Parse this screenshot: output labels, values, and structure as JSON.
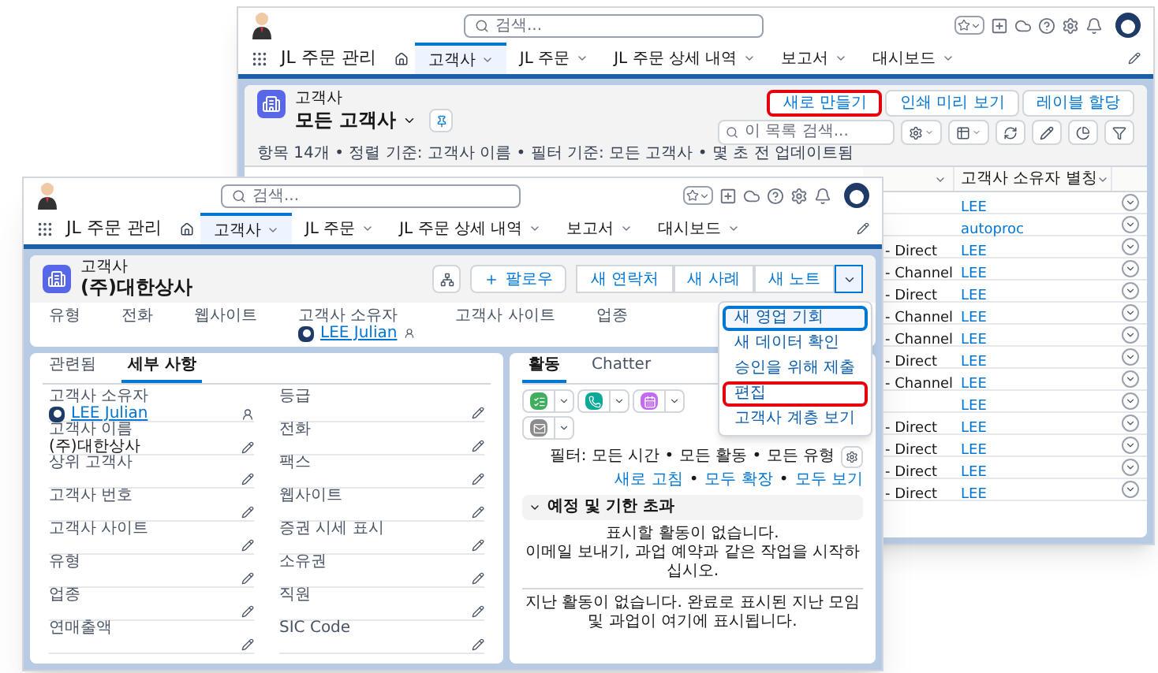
{
  "back_window": {
    "header": {
      "search_placeholder": "검색..."
    },
    "nav": {
      "app_name": "JL 주문 관리",
      "tabs": [
        {
          "label": "고객사",
          "selected": true
        },
        {
          "label": "JL 주문",
          "selected": false
        },
        {
          "label": "JL 주문 상세 내역",
          "selected": false
        },
        {
          "label": "보고서",
          "selected": false
        },
        {
          "label": "대시보드",
          "selected": false
        }
      ]
    },
    "list": {
      "object_label": "고객사",
      "title": "모든 고객사",
      "buttons": [
        {
          "label": "새로 만들기",
          "highlighted": true
        },
        {
          "label": "인쇄 미리 보기",
          "highlighted": false
        },
        {
          "label": "레이블 할당",
          "highlighted": false
        }
      ],
      "search_placeholder": "이 목록 검색...",
      "summary": "항목 14개 • 정렬 기준: 고객사 이름 • 필터 기준: 모든 고객사 • 몇 초 전 업데이트됨",
      "table": {
        "heading": "고객사 소유자 별칭",
        "rows": [
          {
            "owner_alias": "LEE"
          },
          {
            "owner_alias": "autoproc"
          },
          {
            "column_1": "- Direct",
            "owner_alias": "LEE"
          },
          {
            "column_1": "- Channel",
            "owner_alias": "LEE"
          },
          {
            "column_1": "- Direct",
            "owner_alias": "LEE"
          },
          {
            "column_1": "- Channel",
            "owner_alias": "LEE"
          },
          {
            "column_1": "- Channel",
            "owner_alias": "LEE"
          },
          {
            "column_1": "- Direct",
            "owner_alias": "LEE"
          },
          {
            "column_1": "- Channel",
            "owner_alias": "LEE"
          },
          {
            "owner_alias": "LEE"
          },
          {
            "column_1": "- Direct",
            "owner_alias": "LEE"
          },
          {
            "column_1": "- Direct",
            "owner_alias": "LEE"
          },
          {
            "column_1": "- Direct",
            "owner_alias": "LEE"
          },
          {
            "column_1": "- Direct",
            "owner_alias": "LEE"
          }
        ]
      }
    }
  },
  "front_window": {
    "header": {
      "search_placeholder": "검색..."
    },
    "nav": {
      "app_name": "JL 주문 관리",
      "tabs": [
        {
          "label": "고객사",
          "selected": true
        },
        {
          "label": "JL 주문",
          "selected": false
        },
        {
          "label": "JL 주문 상세 내역",
          "selected": false
        },
        {
          "label": "보고서",
          "selected": false
        },
        {
          "label": "대시보드",
          "selected": false
        }
      ]
    },
    "record": {
      "object_label": "고객사",
      "name": "(주)대한상사",
      "follow_label": "팔로우",
      "actions": [
        "새 연락처",
        "새 사례",
        "새 노트"
      ],
      "menu_open": true,
      "menu": [
        {
          "label": "새 영업 기회",
          "focused": true,
          "highlighted": false
        },
        {
          "label": "새 데이터 확인",
          "focused": false,
          "highlighted": false
        },
        {
          "label": "승인을 위해 제출",
          "focused": false,
          "highlighted": false
        },
        {
          "label": "편집",
          "focused": false,
          "highlighted": true
        },
        {
          "label": "고객사 계층 보기",
          "focused": false,
          "highlighted": false
        }
      ],
      "highlights": [
        {
          "label": "유형",
          "kind": "text"
        },
        {
          "label": "전화",
          "kind": "text"
        },
        {
          "label": "웹사이트",
          "kind": "text"
        },
        {
          "label": "고객사 소유자",
          "kind": "user",
          "value": "LEE Julian"
        },
        {
          "label": "고객사 사이트",
          "kind": "text"
        },
        {
          "label": "업종",
          "kind": "text"
        }
      ]
    },
    "details": {
      "tabs": [
        {
          "label": "관련됨",
          "selected": false
        },
        {
          "label": "세부 사항",
          "selected": true
        }
      ],
      "left_fields": [
        {
          "label": "고객사 소유자",
          "kind": "user",
          "value": "LEE Julian"
        },
        {
          "label": "고객사 이름",
          "kind": "text",
          "value": "(주)대한상사"
        },
        {
          "label": "상위 고객사",
          "kind": "text"
        },
        {
          "label": "고객사 번호",
          "kind": "text"
        },
        {
          "label": "고객사 사이트",
          "kind": "text"
        },
        {
          "label": "유형",
          "kind": "text"
        },
        {
          "label": "업종",
          "kind": "text"
        },
        {
          "label": "연매출액",
          "kind": "text"
        }
      ],
      "right_fields": [
        {
          "label": "등급",
          "kind": "text"
        },
        {
          "label": "전화",
          "kind": "text"
        },
        {
          "label": "팩스",
          "kind": "text"
        },
        {
          "label": "웹사이트",
          "kind": "text"
        },
        {
          "label": "증권 시세 표시",
          "kind": "text"
        },
        {
          "label": "소유권",
          "kind": "text"
        },
        {
          "label": "직원",
          "kind": "text"
        },
        {
          "label": "SIC Code",
          "kind": "text"
        }
      ]
    },
    "activity": {
      "tabs": [
        {
          "label": "활동",
          "selected": true
        },
        {
          "label": "Chatter",
          "selected": false
        }
      ],
      "quick_actions": [
        {
          "kind": "task",
          "color": "#3fae5f"
        },
        {
          "kind": "call",
          "color": "#0ca89a"
        },
        {
          "kind": "event",
          "color": "#c46cf0"
        },
        {
          "kind": "email",
          "color": "#8c8c8c"
        }
      ],
      "filter": "필터: 모든 시간 • 모든 활동 • 모든 유형",
      "links": [
        "새로 고침",
        "모두 확장",
        "모두 보기"
      ],
      "link_separator": "•",
      "section": {
        "title": "예정 및 기한 초과",
        "expanded": true,
        "empty_lines": [
          "표시할 활동이 없습니다.",
          "이메일 보내기, 과업 예약과 같은 작업을 시작하십시오."
        ]
      },
      "past_message": "지난 활동이 없습니다. 완료로 표시된 지난 모임 및 과업이 여기에 표시됩니다."
    }
  }
}
